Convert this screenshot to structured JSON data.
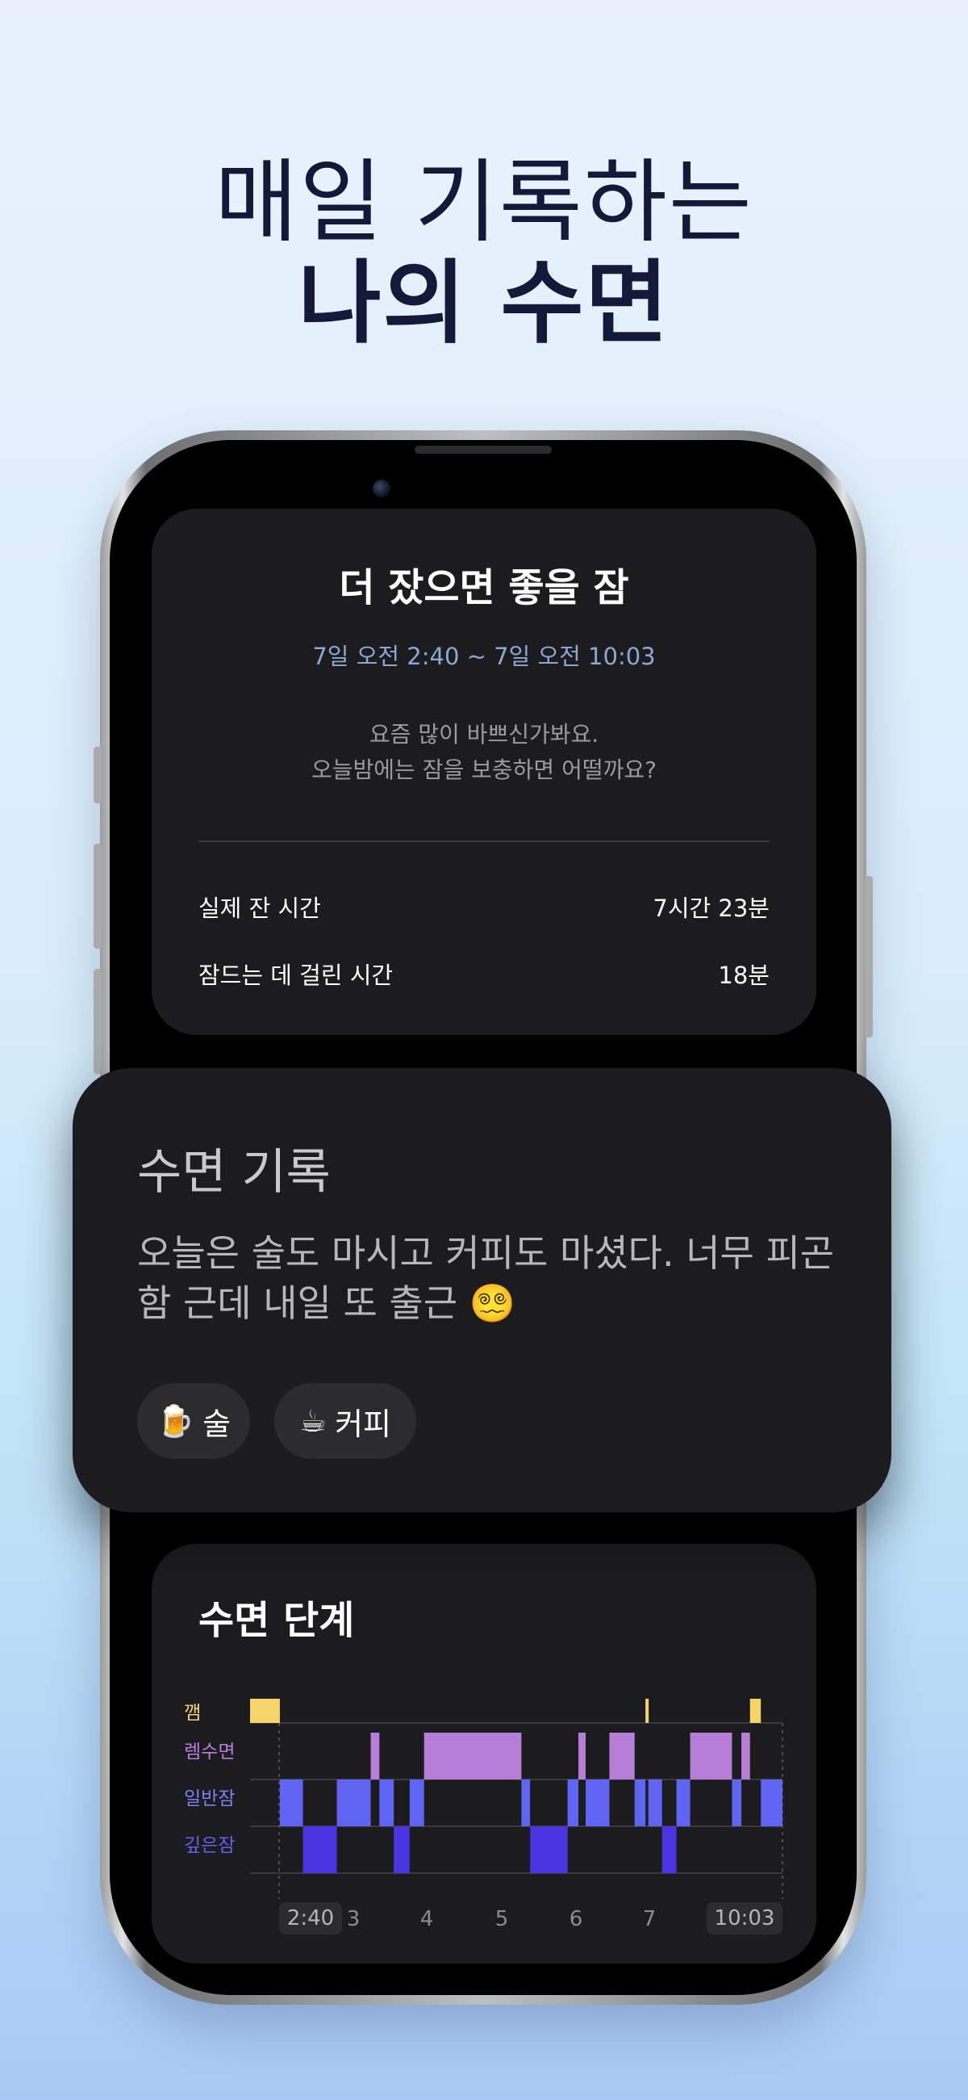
{
  "headline": {
    "line1": "매일 기록하는",
    "line2": "나의 수면"
  },
  "summary": {
    "title": "더 잤으면 좋을 잠",
    "range": "7일 오전 2:40 ~ 7일 오전 10:03",
    "message_line1": "요즘 많이 바쁘신가봐요.",
    "message_line2": "오늘밤에는 잠을 보충하면 어떨까요?",
    "rows": [
      {
        "label": "실제 잔 시간",
        "value": "7시간 23분"
      },
      {
        "label": "잠드는 데 걸린 시간",
        "value": "18분"
      }
    ]
  },
  "record": {
    "title": "수면 기록",
    "note": "오늘은 술도 마시고 커피도 마셨다. 너무 피곤함 근데 내일 또 출근 😵‍💫",
    "tags": [
      {
        "emoji": "🍺",
        "label": "술"
      },
      {
        "emoji": "☕",
        "label": "커피"
      }
    ]
  },
  "stages": {
    "title": "수면 단계",
    "labels": [
      "깸",
      "렘수면",
      "일반잠",
      "깊은잠"
    ],
    "colors": {
      "awake": "#f5d46a",
      "rem": "#b77ed9",
      "core": "#6064f2",
      "deep": "#4934e0"
    },
    "start_label": "2:40",
    "end_label": "10:03",
    "hour_ticks": [
      "3",
      "4",
      "5",
      "6",
      "7"
    ]
  },
  "chart_data": {
    "type": "hypnogram",
    "x_unit": "hour",
    "xlim": [
      2.667,
      10.05
    ],
    "levels": [
      "깸",
      "렘수면",
      "일반잠",
      "깊은잠"
    ],
    "segments": [
      {
        "stage": 0,
        "start": 2.667,
        "end": 3.08
      },
      {
        "stage": 2,
        "start": 3.08,
        "end": 3.4
      },
      {
        "stage": 3,
        "start": 3.4,
        "end": 3.87
      },
      {
        "stage": 2,
        "start": 3.87,
        "end": 4.34
      },
      {
        "stage": 1,
        "start": 4.34,
        "end": 4.46
      },
      {
        "stage": 2,
        "start": 4.46,
        "end": 4.66
      },
      {
        "stage": 3,
        "start": 4.66,
        "end": 4.88
      },
      {
        "stage": 2,
        "start": 4.88,
        "end": 5.08
      },
      {
        "stage": 1,
        "start": 5.08,
        "end": 6.43
      },
      {
        "stage": 2,
        "start": 6.43,
        "end": 6.55
      },
      {
        "stage": 3,
        "start": 6.55,
        "end": 7.07
      },
      {
        "stage": 2,
        "start": 7.07,
        "end": 7.22
      },
      {
        "stage": 1,
        "start": 7.22,
        "end": 7.32
      },
      {
        "stage": 2,
        "start": 7.32,
        "end": 7.65
      },
      {
        "stage": 1,
        "start": 7.65,
        "end": 8.0
      },
      {
        "stage": 2,
        "start": 8.0,
        "end": 8.15
      },
      {
        "stage": 0,
        "start": 8.15,
        "end": 8.19
      },
      {
        "stage": 2,
        "start": 8.19,
        "end": 8.38
      },
      {
        "stage": 3,
        "start": 8.38,
        "end": 8.58
      },
      {
        "stage": 2,
        "start": 8.58,
        "end": 8.77
      },
      {
        "stage": 1,
        "start": 8.77,
        "end": 9.35
      },
      {
        "stage": 2,
        "start": 9.35,
        "end": 9.48
      },
      {
        "stage": 1,
        "start": 9.48,
        "end": 9.6
      },
      {
        "stage": 0,
        "start": 9.6,
        "end": 9.75
      },
      {
        "stage": 2,
        "start": 9.75,
        "end": 10.05
      }
    ]
  }
}
